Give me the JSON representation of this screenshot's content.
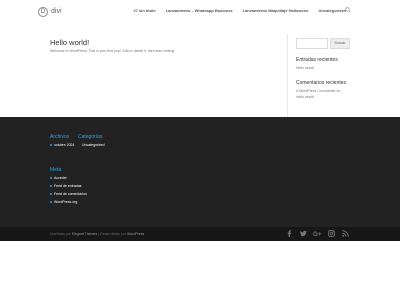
{
  "header": {
    "logo_letter": "D",
    "site_name": "divi",
    "nav": [
      "#7 sin título",
      "Lanzamiento – Whatsapp Business",
      "Lanzamiento Maquillaje Halloween",
      "Uncategorized"
    ]
  },
  "post": {
    "title": "Hello world!",
    "excerpt": "Welcome to WordPress. This is your first post. Edit or delete it, then start writing!"
  },
  "sidebar": {
    "search_button": "Buscar",
    "recent_posts_heading": "Entradas recientes",
    "recent_posts": [
      "Hello world!"
    ],
    "recent_comments_heading": "Comentarios recientes",
    "recent_comments": [
      "A WordPress Commenter en",
      "Hello world!"
    ]
  },
  "footer": {
    "archives_heading": "Archivos",
    "archives": [
      "octubre 2024"
    ],
    "categories_heading": "Categorías",
    "categories": [
      "Uncategorized"
    ],
    "meta_heading": "Meta",
    "meta_links": [
      "Acceder",
      "Feed de entradas",
      "Feed de comentarios",
      "WordPress.org"
    ]
  },
  "bottom": {
    "designed_by": "Diseñado por",
    "theme_author": "Elegant Themes",
    "separator": " | ",
    "powered_by": "Desarrollado por",
    "platform": "WordPress"
  },
  "colors": {
    "accent": "#2ea3f2",
    "footer_bg": "#222222",
    "bottom_bg": "#171717"
  },
  "icons": [
    "search-icon",
    "facebook-icon",
    "twitter-icon",
    "google-plus-icon",
    "instagram-icon",
    "rss-icon"
  ]
}
